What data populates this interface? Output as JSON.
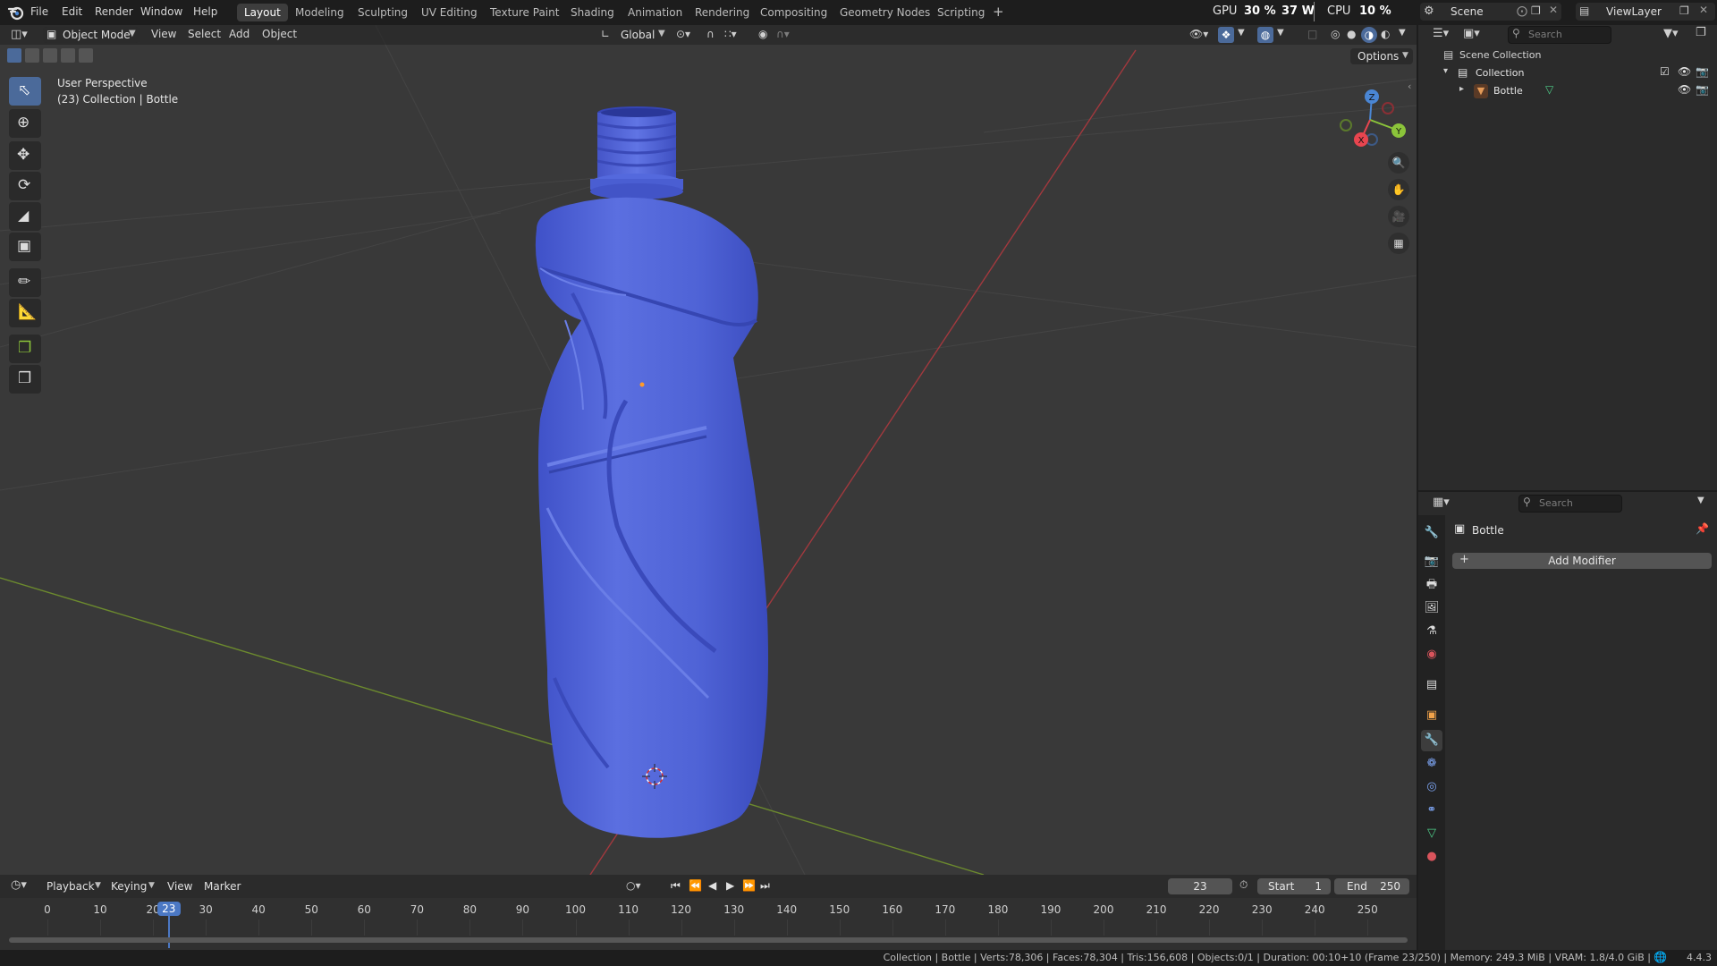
{
  "menubar": {
    "app_icon": "blender-logo-icon",
    "menus": [
      "File",
      "Edit",
      "Render",
      "Window",
      "Help"
    ],
    "workspaces": [
      "Layout",
      "Modeling",
      "Sculpting",
      "UV Editing",
      "Texture Paint",
      "Shading",
      "Animation",
      "Rendering",
      "Compositing",
      "Geometry Nodes",
      "Scripting"
    ],
    "active_workspace": "Layout",
    "add_workspace": "+",
    "gpu_label": "GPU",
    "gpu_value": "30 %",
    "gpu_power": "37 W",
    "cpu_label": "CPU",
    "cpu_value": "10 %",
    "scene_name": "Scene",
    "view_layer": "ViewLayer"
  },
  "viewport_header": {
    "mode": "Object Mode",
    "menus": [
      "View",
      "Select",
      "Add",
      "Object"
    ],
    "transform_orientation": "Global",
    "options_label": "Options"
  },
  "viewport_overlay": {
    "perspective": "User Perspective",
    "collection_info": "(23) Collection | Bottle"
  },
  "navigation_gizmo": {
    "axes": [
      "Z",
      "Y",
      "X"
    ],
    "colors": {
      "x": "#e8454f",
      "y": "#8bc43a",
      "z": "#4a86d4"
    }
  },
  "object": {
    "name": "Bottle",
    "color": "#4f63d6"
  },
  "outliner": {
    "search_placeholder": "Search",
    "root": "Scene Collection",
    "collection": "Collection",
    "object": "Bottle"
  },
  "properties": {
    "search_placeholder": "Search",
    "object_name": "Bottle",
    "add_modifier_label": "Add Modifier",
    "tabs": [
      "tool-icon",
      "render-icon",
      "output-icon",
      "view-layer-icon",
      "scene-icon",
      "world-icon",
      "collection-icon",
      "object-icon",
      "modifier-icon",
      "particles-icon",
      "physics-icon",
      "constraints-icon",
      "data-icon",
      "material-icon"
    ],
    "active_tab": "modifier-icon"
  },
  "timeline": {
    "menus": [
      "Playback",
      "Keying",
      "View",
      "Marker"
    ],
    "current_frame": "23",
    "start_label": "Start",
    "start_value": "1",
    "end_label": "End",
    "end_value": "250",
    "ruler": [
      "0",
      "10",
      "20",
      "30",
      "40",
      "50",
      "60",
      "70",
      "80",
      "90",
      "100",
      "110",
      "120",
      "130",
      "140",
      "150",
      "160",
      "170",
      "180",
      "190",
      "200",
      "210",
      "220",
      "230",
      "240",
      "250"
    ],
    "ruler_frames": [
      0,
      10,
      20,
      30,
      40,
      50,
      60,
      70,
      80,
      90,
      100,
      110,
      120,
      130,
      140,
      150,
      160,
      170,
      180,
      190,
      200,
      210,
      220,
      230,
      240,
      250
    ],
    "playhead_frame": 23
  },
  "statusbar": {
    "text": "Collection | Bottle | Verts:78,306 | Faces:78,304 | Tris:156,608 | Objects:0/1 | Duration: 00:10+10 (Frame 23/250) | Memory: 249.3 MiB | VRAM: 1.8/4.0 GiB |",
    "version": "4.4.3"
  }
}
